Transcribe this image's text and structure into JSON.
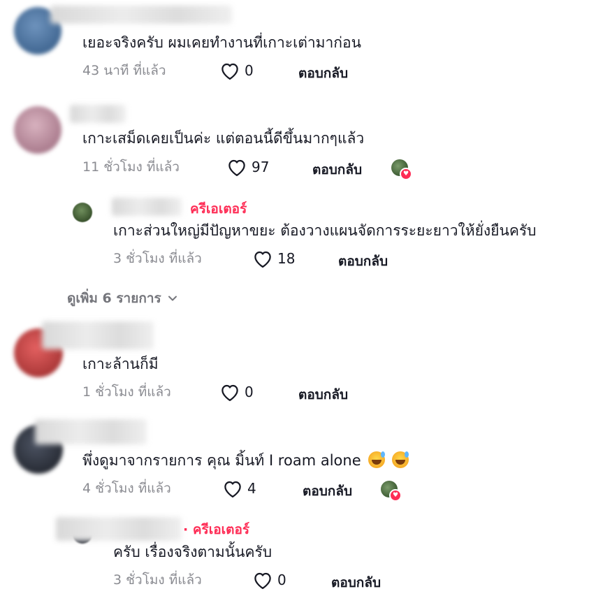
{
  "comments": [
    {
      "text": "เยอะจริงครับ ผมเคยทำงานที่เกาะเต่ามาก่อน",
      "time": "43 นาที ที่แล้ว",
      "likes": "0",
      "reply_label": "ตอบกลับ",
      "avatar_color": "#5a7fa8"
    },
    {
      "text": "เกาะเสม็ดเคยเป็นค่ะ แต่ตอนนี้ดีขึ้นมากๆแล้ว",
      "time": "11 ชั่วโมง ที่แล้ว",
      "likes": "97",
      "reply_label": "ตอบกลับ",
      "avatar_color": "#c59aa8"
    },
    {
      "creator_badge": "ครีเอเตอร์",
      "text": "เกาะส่วนใหญ่มีปัญหาขยะ ต้องวางแผนจัดการระยะยาวให้ยั่งยืนครับ",
      "time": "3 ชั่วโมง ที่แล้ว",
      "likes": "18",
      "reply_label": "ตอบกลับ"
    },
    {
      "text": "เกาะล้านก็มี",
      "time": "1 ชั่วโมง ที่แล้ว",
      "likes": "0",
      "reply_label": "ตอบกลับ",
      "avatar_color": "#c94848"
    },
    {
      "text": "พึ่งดูมาจากรายการ คุณ มิ้นท์ I roam alone",
      "time": "4 ชั่วโมง ที่แล้ว",
      "likes": "4",
      "reply_label": "ตอบกลับ",
      "avatar_color": "#3b4250"
    },
    {
      "creator_badge": "ครีเอเตอร์",
      "text": "ครับ เรื่องจริงตามนั้นครับ",
      "time": "3 ชั่วโมง ที่แล้ว",
      "likes": "0",
      "reply_label": "ตอบกลับ"
    }
  ],
  "view_more": "ดูเพิ่ม 6 รายการ",
  "colors": {
    "creator": "#fe2c55",
    "meta": "#8a8b91",
    "text": "#161823"
  },
  "icons": [
    "heart-outline-icon",
    "chevron-down-icon",
    "creator-liked-avatar-icon",
    "grinning-sweat-emoji-icon"
  ]
}
